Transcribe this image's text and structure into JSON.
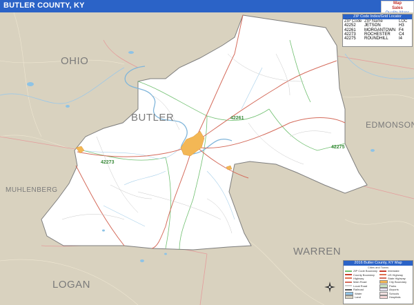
{
  "title": "BUTLER COUNTY, KY",
  "brand": {
    "line1": "Map",
    "line2": "Sales",
    "line3": "Quality Maps"
  },
  "county_labels": [
    "OHIO",
    "BUTLER",
    "EDMONSON",
    "MUHLENBERG",
    "WARREN",
    "LOGAN"
  ],
  "zip_labels": [
    "42261",
    "42273",
    "42275"
  ],
  "zip_table": {
    "header": "ZIP Code Index/Grid Locator",
    "columns": [
      "ZIP Code",
      "ZIP Name",
      "LOC"
    ],
    "rows": [
      {
        "zip": "42252",
        "name": "JETSON",
        "loc": "H3"
      },
      {
        "zip": "42261",
        "name": "MORGANTOWN",
        "loc": "F4"
      },
      {
        "zip": "42273",
        "name": "ROCHESTER",
        "loc": "C4"
      },
      {
        "zip": "42275",
        "name": "ROUNDHILL",
        "loc": "I4"
      }
    ]
  },
  "legend": {
    "header": "2016 Butler County, KY Map",
    "subheader": "Cities and Towns",
    "left": [
      "ZIP Code Boundary",
      "County Boundary",
      "Highway",
      "Main Road",
      "Local Road",
      "Railroad",
      "Water",
      "Land"
    ],
    "right": [
      "Interstate",
      "US Highway",
      "State Highway",
      "City Boundary",
      "Parks",
      "Airports",
      "Schools",
      "Hospitals"
    ],
    "colors": {
      "zip": "#6fbf6f",
      "county": "#c83c2c",
      "highway": "#e07050",
      "road": "#cccccc",
      "water": "#8ec3e6",
      "land": "#d9d2bf",
      "city": "#f3b755"
    }
  },
  "colors": {
    "title_bar": "#2b63c7",
    "outside_land": "#d9d2bf",
    "county_fill": "#ffffff",
    "county_border": "#7d7d7d",
    "roads": "#d46a5a",
    "rivers": "#7fb5da",
    "zip_lines": "#6fbf6f",
    "towns": "#f3b755"
  }
}
